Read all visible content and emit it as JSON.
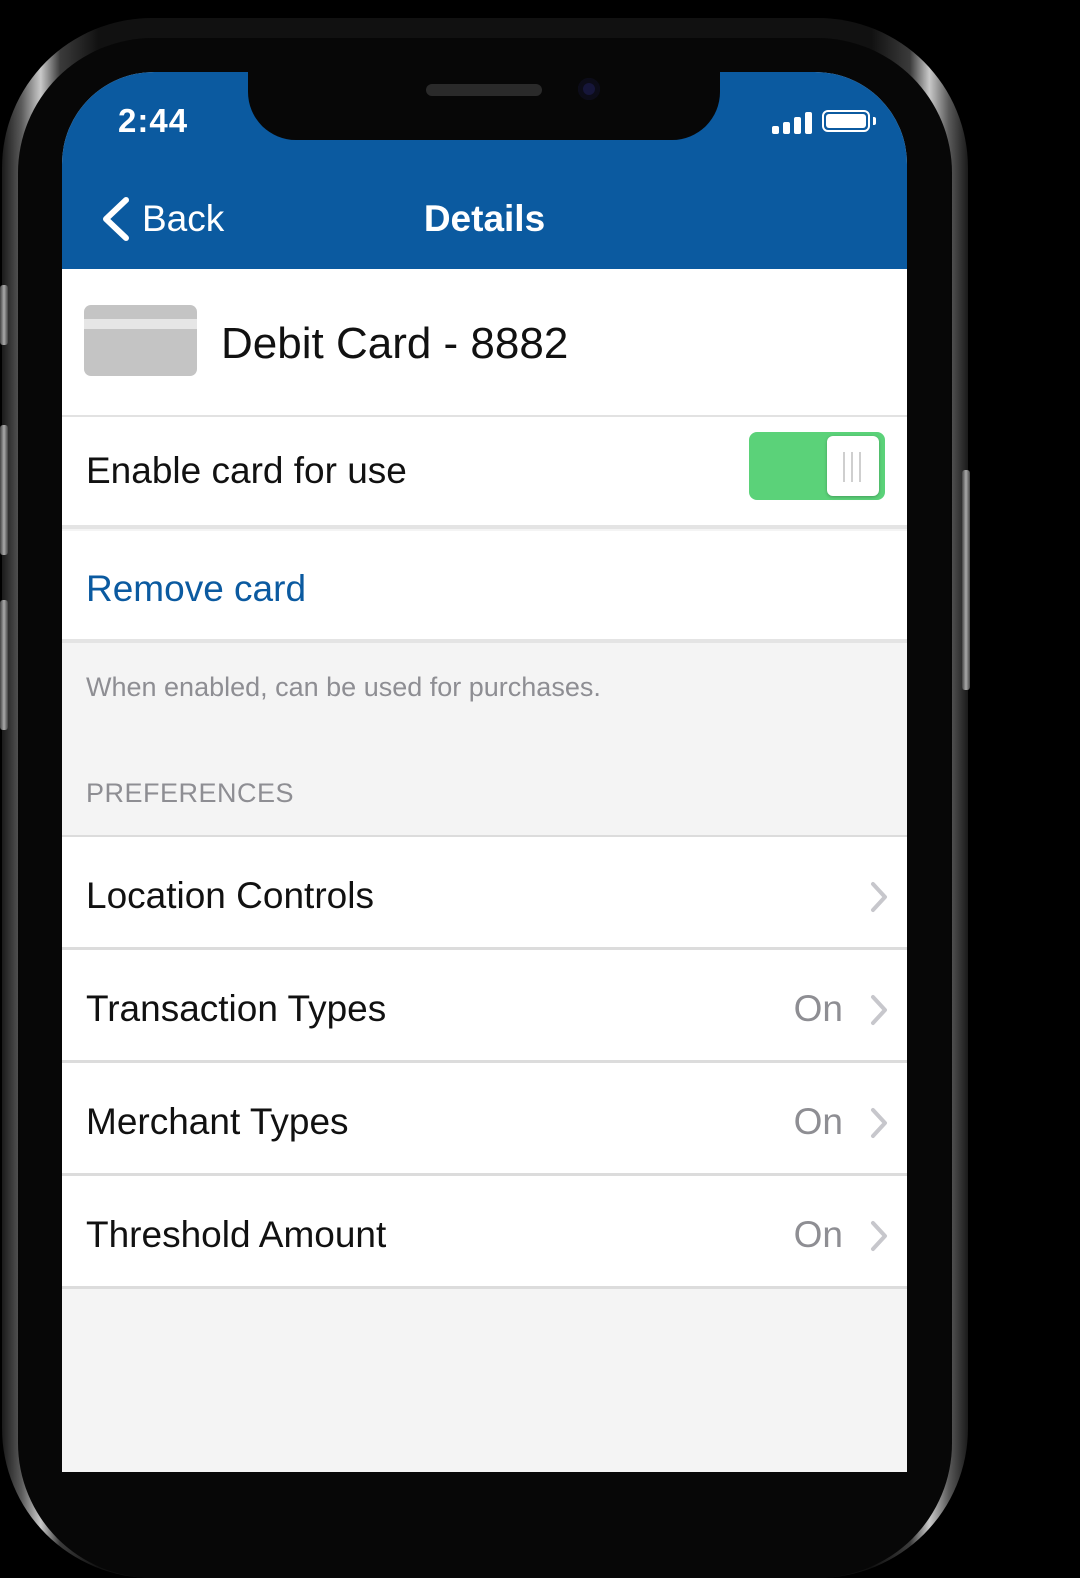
{
  "status_bar": {
    "time": "2:44"
  },
  "nav": {
    "back_label": "Back",
    "title": "Details"
  },
  "card": {
    "name": "Debit Card - 8882"
  },
  "enable_row": {
    "label": "Enable card for use",
    "toggle_on": true
  },
  "remove_row": {
    "label": "Remove card"
  },
  "hint": "When enabled, can be used for purchases.",
  "preferences": {
    "header": "PREFERENCES",
    "items": [
      {
        "label": "Location Controls",
        "value": ""
      },
      {
        "label": "Transaction Types",
        "value": "On"
      },
      {
        "label": "Merchant Types",
        "value": "On"
      },
      {
        "label": "Threshold Amount",
        "value": "On"
      }
    ]
  },
  "colors": {
    "header": "#0b5aa0",
    "toggle": "#5bd279",
    "link": "#0b5aa0"
  }
}
